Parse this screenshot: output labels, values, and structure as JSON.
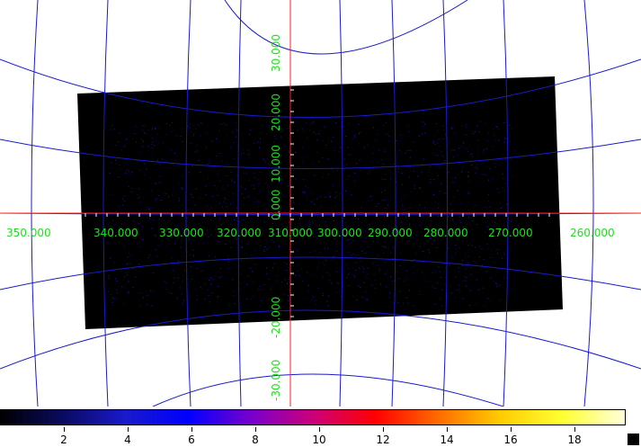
{
  "viewer": {
    "grid_color": "#1a1acc",
    "crosshair_color": "#ff2020",
    "label_color": "#22dd22",
    "image_color": "#000000"
  },
  "ra_labels": [
    "350.000",
    "340.000",
    "330.000",
    "320.000",
    "310.000",
    "300.000",
    "290.000",
    "280.000",
    "270.000",
    "260.000"
  ],
  "dec_labels": [
    "30.000",
    "20.000",
    "10.000",
    "0.000",
    "-20.000",
    "-30.000"
  ],
  "colorbar": {
    "ticks": [
      "2",
      "4",
      "6",
      "8",
      "10",
      "12",
      "14",
      "16",
      "18"
    ],
    "stops": [
      "#000000",
      "#0a0a60",
      "#1a1acc",
      "#0000ff",
      "#7700cc",
      "#cc0077",
      "#ff0000",
      "#ff6a00",
      "#ffcc00",
      "#ffff33",
      "#ffffdd"
    ]
  }
}
